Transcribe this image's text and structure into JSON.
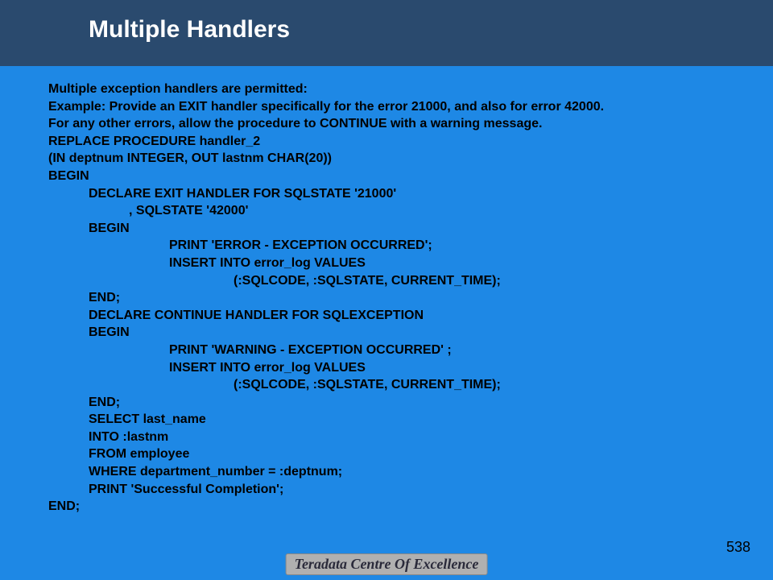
{
  "header": {
    "title": "Multiple Handlers"
  },
  "content": {
    "intro1": "Multiple exception handlers are permitted:",
    "intro2": "Example: Provide an EXIT handler specifically for the error 21000, and also for error 42000.",
    "intro3": "For any other errors, allow the procedure to CONTINUE with a warning message.",
    "l1": "REPLACE PROCEDURE handler_2",
    "l2": "(IN deptnum INTEGER, OUT lastnm CHAR(20))",
    "l3": "BEGIN",
    "l4": "DECLARE EXIT HANDLER FOR SQLSTATE '21000'",
    "l5": ", SQLSTATE '42000'",
    "l6": "BEGIN",
    "l7": "PRINT 'ERROR - EXCEPTION OCCURRED';",
    "l8": "INSERT INTO error_log VALUES",
    "l9": "(:SQLCODE, :SQLSTATE, CURRENT_TIME);",
    "l10": "END;",
    "l11": "DECLARE CONTINUE HANDLER FOR SQLEXCEPTION",
    "l12": "BEGIN",
    "l13": "PRINT 'WARNING - EXCEPTION OCCURRED' ;",
    "l14": "INSERT INTO error_log VALUES",
    "l15": "(:SQLCODE, :SQLSTATE, CURRENT_TIME);",
    "l16": "END;",
    "l17": "SELECT last_name",
    "l18": "INTO :lastnm",
    "l19": "FROM employee",
    "l20": "WHERE department_number = :deptnum;",
    "l21": "PRINT 'Successful Completion';",
    "l22": "END;"
  },
  "footer": {
    "logo": "Teradata Centre Of Excellence",
    "page": "538"
  }
}
